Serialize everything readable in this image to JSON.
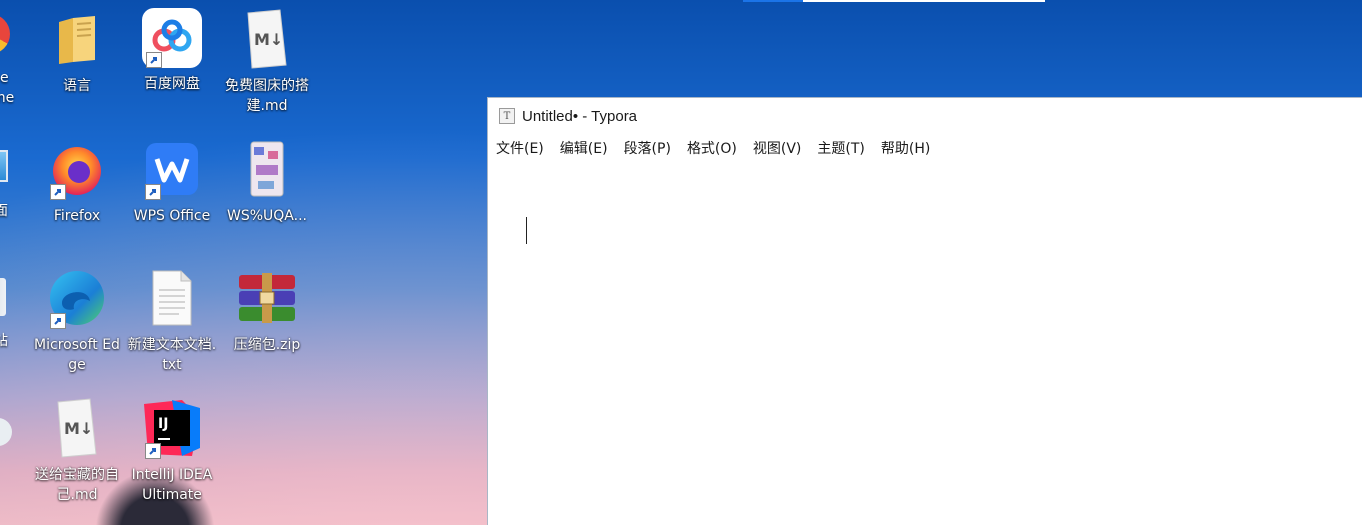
{
  "window": {
    "title": "Untitled• - Typora",
    "app_icon_letter": "T",
    "menu": [
      "文件(E)",
      "编辑(E)",
      "段落(P)",
      "格式(O)",
      "视图(V)",
      "主题(T)",
      "帮助(H)"
    ]
  },
  "desktop": {
    "partial_left": [
      "e",
      "me",
      "面",
      "站"
    ],
    "icons": [
      {
        "label": "语言",
        "icon": "folder-icon"
      },
      {
        "label": "百度网盘",
        "icon": "baidu-netdisk-icon"
      },
      {
        "label": "免费图床的搭建.md",
        "icon": "markdown-file-icon"
      },
      {
        "label": "Firefox",
        "icon": "firefox-icon"
      },
      {
        "label": "WPS Office",
        "icon": "wps-office-icon"
      },
      {
        "label": "WS%UQA...",
        "icon": "image-file-icon"
      },
      {
        "label": "Microsoft Edge",
        "icon": "edge-icon"
      },
      {
        "label": "新建文本文档.txt",
        "icon": "text-file-icon"
      },
      {
        "label": "压缩包.zip",
        "icon": "winrar-archive-icon"
      },
      {
        "label": "送给宝藏的自己.md",
        "icon": "markdown-file-icon"
      },
      {
        "label": "IntelliJ IDEA Ultimate",
        "icon": "intellij-idea-icon"
      }
    ]
  }
}
